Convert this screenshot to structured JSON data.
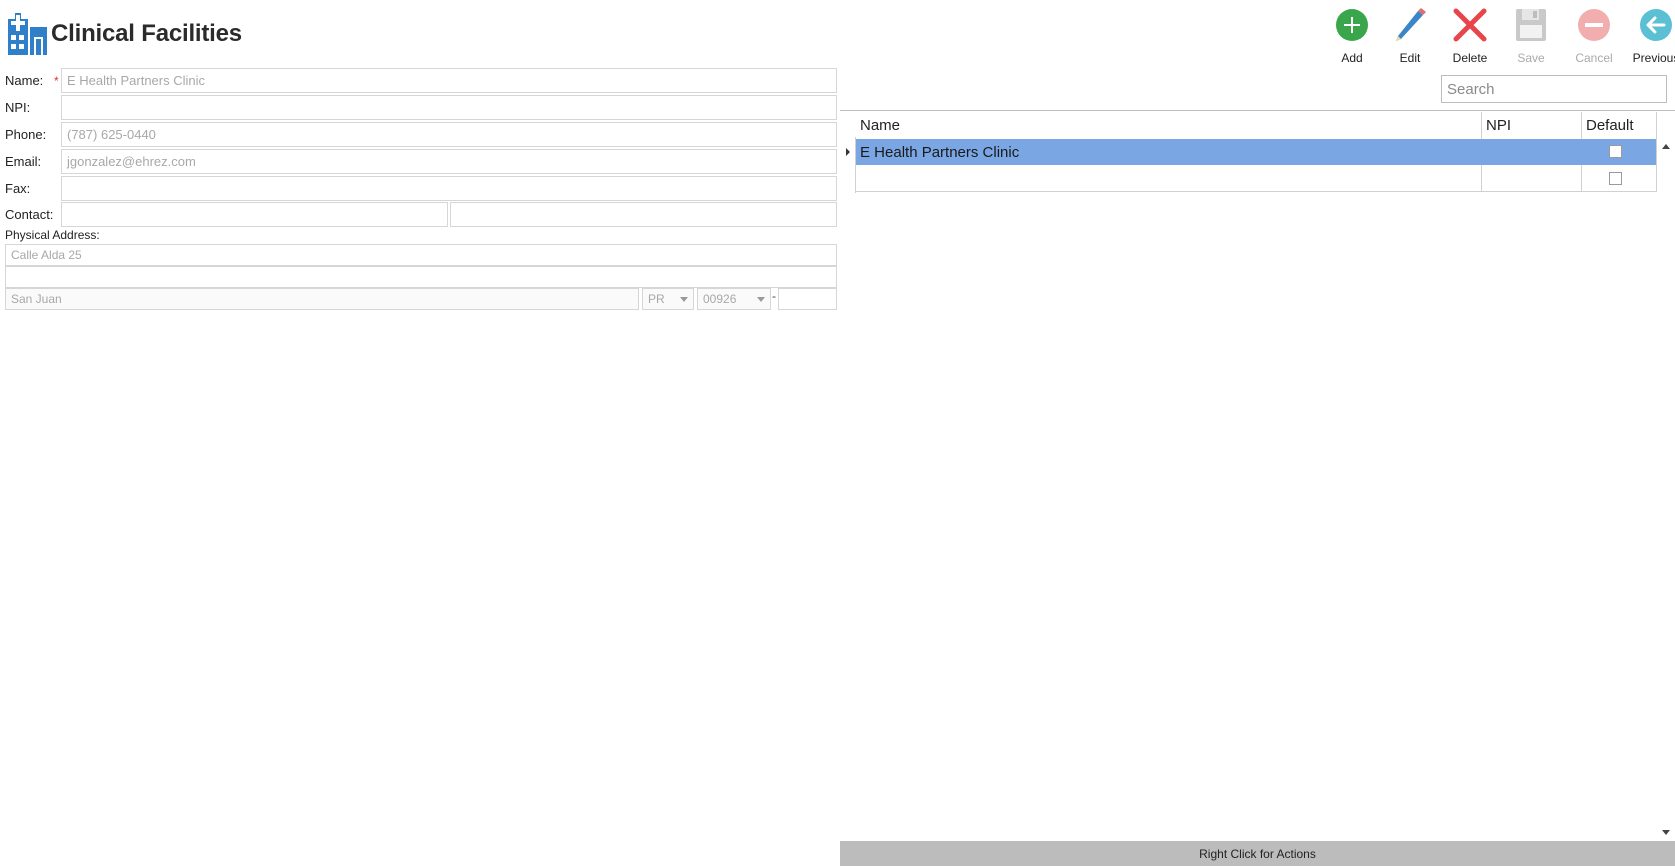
{
  "header": {
    "title": "Clinical Facilities",
    "icon": "hospital-building-icon"
  },
  "toolbar": {
    "add_label": "Add",
    "edit_label": "Edit",
    "delete_label": "Delete",
    "save_label": "Save",
    "cancel_label": "Cancel",
    "previous_label": "Previous"
  },
  "form": {
    "name_label": "Name:",
    "required_mark": "*",
    "name_value": "E Health Partners Clinic",
    "npi_label": "NPI:",
    "npi_value": "",
    "phone_label": "Phone:",
    "phone_value": "(787) 625-0440",
    "email_label": "Email:",
    "email_value": "jgonzalez@ehrez.com",
    "fax_label": "Fax:",
    "fax_value": "",
    "contact_label": "Contact:",
    "contact_first": "",
    "contact_last": "",
    "address_label": "Physical Address:",
    "address_line1": "Calle Alda 25",
    "address_line2": "",
    "city": "San Juan",
    "state": "PR",
    "zip": "00926",
    "zip_sep": "-",
    "zip_ext": ""
  },
  "search": {
    "placeholder": "Search"
  },
  "grid": {
    "columns": [
      "Name",
      "NPI",
      "Default"
    ],
    "rows": [
      {
        "name": "E Health Partners Clinic",
        "npi": "",
        "default": false,
        "selected": true
      },
      {
        "name": "",
        "npi": "",
        "default": false,
        "selected": false
      }
    ]
  },
  "status_bar": {
    "text": "Right Click for Actions"
  },
  "colors": {
    "selected_row": "#7aa7e4",
    "add": "#3aa64b",
    "edit": "#3a86c8",
    "delete": "#e8454b",
    "previous": "#5bc0d4"
  }
}
